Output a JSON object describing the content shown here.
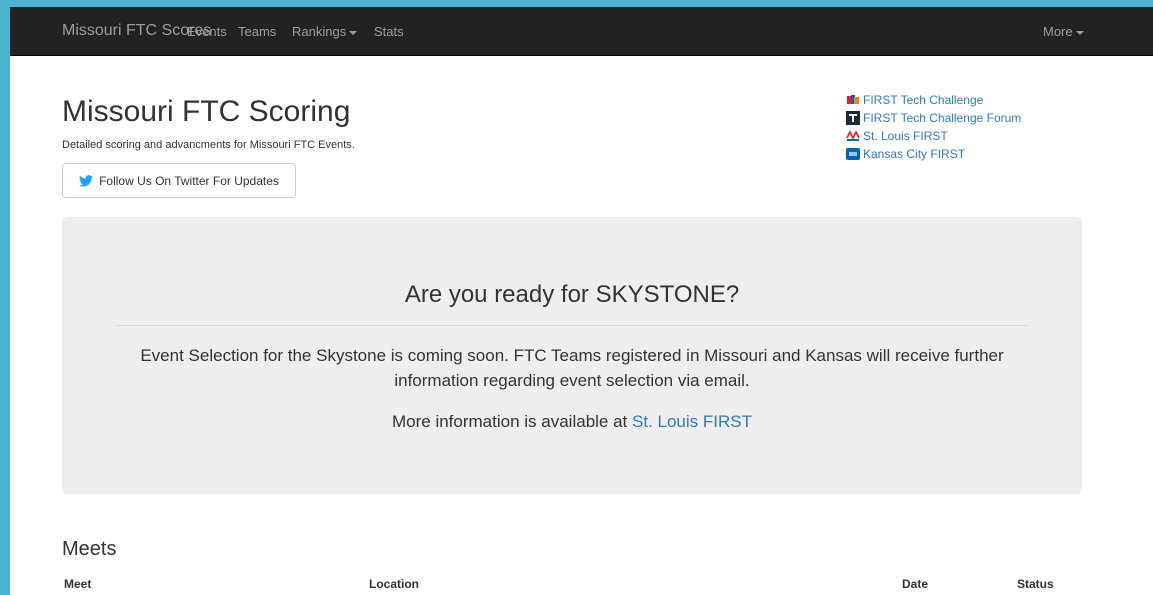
{
  "navbar": {
    "brand": "Missouri FTC Scores",
    "items": [
      {
        "label": "Events"
      },
      {
        "label": "Teams"
      },
      {
        "label": "Rankings"
      },
      {
        "label": "Stats"
      }
    ],
    "more_label": "More"
  },
  "header": {
    "title": "Missouri FTC Scoring",
    "subtitle": "Detailed scoring and advancments for Missouri FTC Events.",
    "twitter_button": "Follow Us On Twitter For Updates"
  },
  "links": [
    {
      "label": "FIRST Tech Challenge",
      "icon": "ftc-logo-icon"
    },
    {
      "label": "FIRST Tech Challenge Forum",
      "icon": "forum-logo-icon"
    },
    {
      "label": "St. Louis FIRST",
      "icon": "stl-first-logo-icon"
    },
    {
      "label": "Kansas City FIRST",
      "icon": "kc-first-logo-icon"
    }
  ],
  "jumbotron": {
    "title": "Are you ready for SKYSTONE?",
    "text": "Event Selection for the Skystone is coming soon. FTC Teams registered in Missouri and Kansas will receive further information regarding event selection via email.",
    "more_prefix": "More information is available at ",
    "more_link": "St. Louis FIRST"
  },
  "meets": {
    "title": "Meets",
    "columns": [
      "Meet",
      "Location",
      "Date",
      "Status"
    ]
  },
  "colors": {
    "navbar_bg": "#222222",
    "link": "#337ab7",
    "jumbotron_bg": "#eeeeee",
    "twitter": "#1da1f2",
    "outer_bg": "#4bb3cf"
  }
}
